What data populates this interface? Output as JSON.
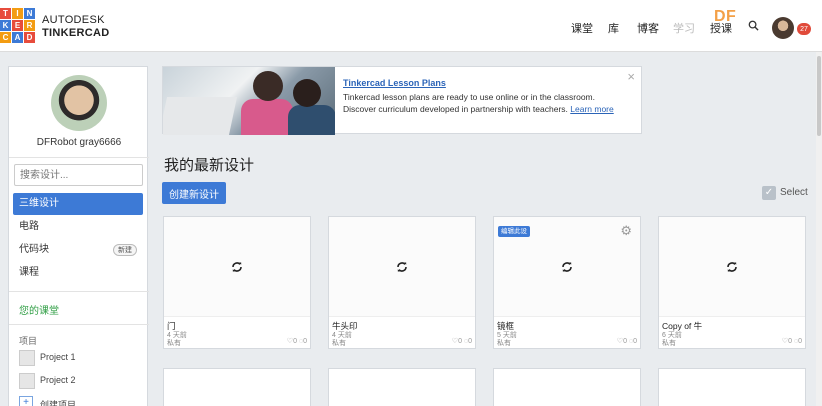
{
  "logo": {
    "letters": [
      "T",
      "I",
      "N",
      "K",
      "E",
      "R",
      "C",
      "A",
      "D"
    ],
    "colors": [
      "#e74c3c",
      "#f39c12",
      "#3d7ad6",
      "#3d7ad6",
      "#e74c3c",
      "#f39c12",
      "#f39c12",
      "#3d7ad6",
      "#e74c3c"
    ],
    "brand_line1": "AUTODESK",
    "brand_line2": "TINKERCAD"
  },
  "nav": {
    "classroom": "课堂",
    "library": "库",
    "blog": "博客",
    "learn": "学习",
    "teach": "授课",
    "notification_count": "27",
    "watermark": "DF"
  },
  "sidebar": {
    "user_name": "DFRobot gray6666",
    "search_placeholder": "搜索设计...",
    "items": [
      {
        "label": "三维设计",
        "active": true
      },
      {
        "label": "电路",
        "active": false
      },
      {
        "label": "代码块",
        "active": false,
        "tag": "新建"
      },
      {
        "label": "课程",
        "active": false
      }
    ],
    "classroom_link": "您的课堂",
    "projects_heading": "项目",
    "projects": [
      "Project 1",
      "Project 2"
    ],
    "create_project": "创建项目"
  },
  "lesson": {
    "title": "Tinkercad Lesson Plans",
    "body": "Tinkercad lesson plans are ready to use online or in the classroom. Discover curriculum developed in partnership with teachers.",
    "link": "Learn more",
    "close": "×"
  },
  "designs": {
    "title": "我的最新设计",
    "create_button": "创建新设计",
    "select_label": "Select",
    "cards": [
      {
        "name": "门",
        "age": "4 天前",
        "privacy": "私有",
        "likes": "0",
        "comments": "0",
        "tag": ""
      },
      {
        "name": "牛头印",
        "age": "4 天前",
        "privacy": "私有",
        "likes": "0",
        "comments": "0",
        "tag": ""
      },
      {
        "name": "镜框",
        "age": "5 天前",
        "privacy": "私有",
        "likes": "0",
        "comments": "0",
        "tag": "编辑此设"
      },
      {
        "name": "Copy of 牛",
        "age": "6 天前",
        "privacy": "私有",
        "likes": "0",
        "comments": "0",
        "tag": ""
      }
    ]
  }
}
